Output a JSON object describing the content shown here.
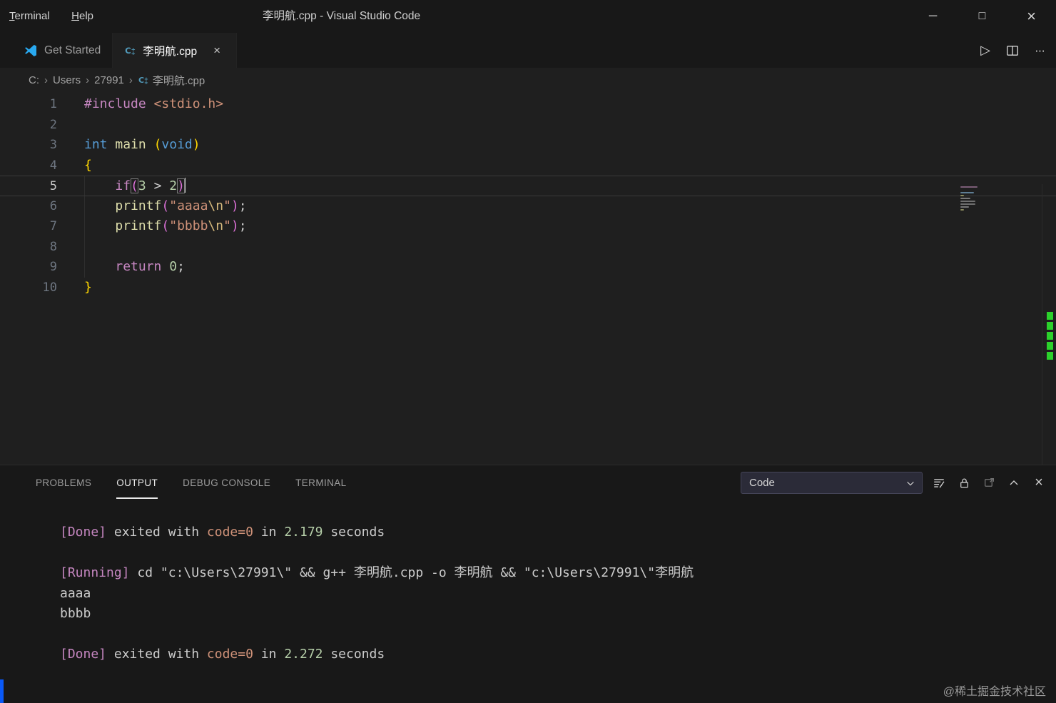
{
  "title_bar": {
    "menus": [
      {
        "label": "Terminal"
      },
      {
        "label": "Help"
      }
    ],
    "window_title": "李明航.cpp - Visual Studio Code"
  },
  "icons": {
    "run": "▷",
    "more": "···",
    "minimize": "─",
    "maximize": "□",
    "close": "×",
    "tab_close": "×",
    "breadcrumb_sep": "›"
  },
  "tab_bar": {
    "tabs": [
      {
        "label": "Get Started",
        "icon": "vscode-logo",
        "active": false
      },
      {
        "label": "李明航.cpp",
        "icon": "cpp-file-icon",
        "active": true,
        "closable": true
      }
    ]
  },
  "breadcrumb": {
    "items": [
      "C:",
      "Users",
      "27991"
    ],
    "file": "李明航.cpp"
  },
  "editor": {
    "language": "cpp",
    "lines": [
      {
        "n": "1",
        "tokens": [
          {
            "t": "#include",
            "c": "pink"
          },
          {
            "t": " ",
            "c": "d"
          },
          {
            "t": "<stdio.h>",
            "c": "str"
          }
        ]
      },
      {
        "n": "2",
        "tokens": []
      },
      {
        "n": "3",
        "tokens": [
          {
            "t": "int",
            "c": "blue"
          },
          {
            "t": " ",
            "c": "d"
          },
          {
            "t": "main",
            "c": "fn"
          },
          {
            "t": " ",
            "c": "d"
          },
          {
            "t": "(",
            "c": "gold"
          },
          {
            "t": "void",
            "c": "blue"
          },
          {
            "t": ")",
            "c": "gold"
          }
        ]
      },
      {
        "n": "4",
        "tokens": [
          {
            "t": "{",
            "c": "gold"
          }
        ]
      },
      {
        "n": "5",
        "current": true,
        "guide": true,
        "tokens": [
          {
            "t": "    ",
            "c": "d"
          },
          {
            "t": "if",
            "c": "pink"
          },
          {
            "t": "(",
            "c": "purple",
            "box": true
          },
          {
            "t": "3",
            "c": "num"
          },
          {
            "t": " > ",
            "c": "d"
          },
          {
            "t": "2",
            "c": "num"
          },
          {
            "t": ")",
            "c": "purple",
            "box": true
          },
          {
            "t": "",
            "c": "cursor"
          }
        ]
      },
      {
        "n": "6",
        "guide": true,
        "tokens": [
          {
            "t": "    ",
            "c": "d"
          },
          {
            "t": "printf",
            "c": "fn"
          },
          {
            "t": "(",
            "c": "purple"
          },
          {
            "t": "\"aaaa",
            "c": "str"
          },
          {
            "t": "\\n",
            "c": "esc"
          },
          {
            "t": "\"",
            "c": "str"
          },
          {
            "t": ")",
            "c": "purple"
          },
          {
            "t": ";",
            "c": "d"
          }
        ]
      },
      {
        "n": "7",
        "guide": true,
        "tokens": [
          {
            "t": "    ",
            "c": "d"
          },
          {
            "t": "printf",
            "c": "fn"
          },
          {
            "t": "(",
            "c": "purple"
          },
          {
            "t": "\"bbbb",
            "c": "str"
          },
          {
            "t": "\\n",
            "c": "esc"
          },
          {
            "t": "\"",
            "c": "str"
          },
          {
            "t": ")",
            "c": "purple"
          },
          {
            "t": ";",
            "c": "d"
          }
        ]
      },
      {
        "n": "8",
        "guide": true,
        "tokens": []
      },
      {
        "n": "9",
        "guide": true,
        "tokens": [
          {
            "t": "    ",
            "c": "d"
          },
          {
            "t": "return",
            "c": "pink"
          },
          {
            "t": " ",
            "c": "d"
          },
          {
            "t": "0",
            "c": "num"
          },
          {
            "t": ";",
            "c": "d"
          }
        ]
      },
      {
        "n": "10",
        "tokens": [
          {
            "t": "}",
            "c": "gold"
          }
        ]
      }
    ]
  },
  "panel": {
    "tabs": [
      {
        "label": "PROBLEMS",
        "active": false
      },
      {
        "label": "OUTPUT",
        "active": true
      },
      {
        "label": "DEBUG CONSOLE",
        "active": false
      },
      {
        "label": "TERMINAL",
        "active": false
      }
    ],
    "channel_dropdown": {
      "value": "Code"
    },
    "output_lines": [
      {
        "tokens": [
          {
            "t": "[Done]",
            "c": "pink"
          },
          {
            "t": " exited with ",
            "c": "d"
          },
          {
            "t": "code=0",
            "c": "str"
          },
          {
            "t": " in ",
            "c": "d"
          },
          {
            "t": "2.179",
            "c": "num"
          },
          {
            "t": " seconds",
            "c": "d"
          }
        ]
      },
      {
        "tokens": []
      },
      {
        "tokens": [
          {
            "t": "[Running]",
            "c": "pink"
          },
          {
            "t": " cd \"c:\\Users\\27991\\\" && g++ 李明航.cpp -o 李明航 && \"c:\\Users\\27991\\\"李明航",
            "c": "d"
          }
        ]
      },
      {
        "tokens": [
          {
            "t": "aaaa",
            "c": "d"
          }
        ]
      },
      {
        "tokens": [
          {
            "t": "bbbb",
            "c": "d"
          }
        ]
      },
      {
        "tokens": []
      },
      {
        "tokens": [
          {
            "t": "[Done]",
            "c": "pink"
          },
          {
            "t": " exited with ",
            "c": "d"
          },
          {
            "t": "code=0",
            "c": "str"
          },
          {
            "t": " in ",
            "c": "d"
          },
          {
            "t": "2.272",
            "c": "num"
          },
          {
            "t": " seconds",
            "c": "d"
          }
        ]
      }
    ]
  },
  "watermark": "@稀土掘金技术社区",
  "colors": {
    "titlebar_bg": "#181818",
    "editor_bg": "#1f1f1f",
    "keyword_pink": "#c586c0",
    "type_blue": "#569cd6",
    "function_yellow": "#dcdcaa",
    "string_orange": "#ce9178",
    "number_green": "#b5cea8",
    "brace_gold": "#ffd700",
    "paren_purple": "#da70d6",
    "overview_mark_green": "#2bd12b"
  }
}
